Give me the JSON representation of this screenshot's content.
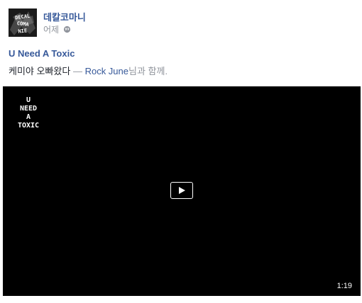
{
  "post": {
    "page_name": "데칼코마니",
    "timestamp": "어제",
    "privacy_icon": "globe-icon",
    "title": "U Need A Toxic",
    "text_main": "케미야 오빠왔다",
    "text_separator": " — ",
    "tagged_user": "Rock June",
    "text_with": "님과 함께."
  },
  "avatar": {
    "logo_text": "DECALCOMANIE"
  },
  "video": {
    "overlay_lines": [
      "U",
      "NEED",
      "A",
      "TOXIC"
    ],
    "duration": "1:19",
    "play_icon": "play-icon"
  }
}
